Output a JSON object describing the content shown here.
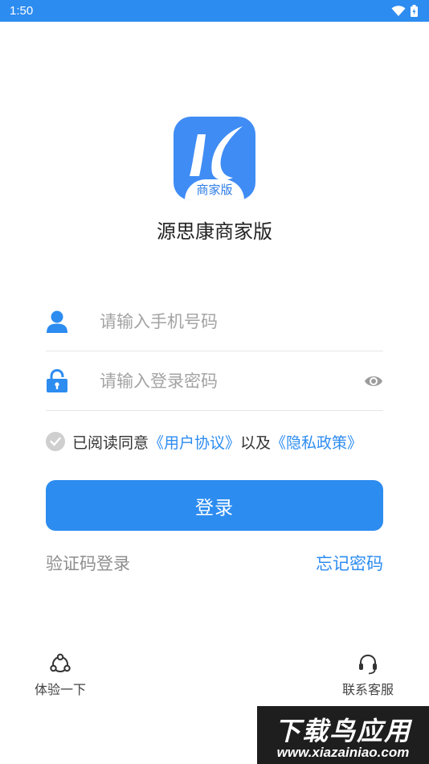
{
  "status_bar": {
    "time": "1:50",
    "icons": [
      "wifi-icon",
      "battery-icon"
    ],
    "color": "#2d8cf0"
  },
  "logo": {
    "badge": "商家版",
    "color": "#3f8cf5"
  },
  "app_name": "源思康商家版",
  "phone_field": {
    "placeholder": "请输入手机号码",
    "value": "",
    "icon": "user-icon"
  },
  "password_field": {
    "placeholder": "请输入登录密码",
    "value": "",
    "icon": "lock-icon",
    "toggle_icon": "eye-icon"
  },
  "agreement": {
    "checked": true,
    "prefix": "已阅读同意",
    "user_agreement": "《用户协议》",
    "connector": "以及",
    "privacy_policy": "《隐私政策》"
  },
  "login_button": "登录",
  "sms_login": "验证码登录",
  "forgot_password": "忘记密码",
  "bottom": {
    "trial": {
      "label": "体验一下",
      "icon": "share-icon"
    },
    "service": {
      "label": "联系客服",
      "icon": "headset-icon"
    }
  },
  "watermark": {
    "title": "下载鸟应用",
    "url": "www.xiazainiao.com"
  },
  "accent_color": "#2d8cf0"
}
